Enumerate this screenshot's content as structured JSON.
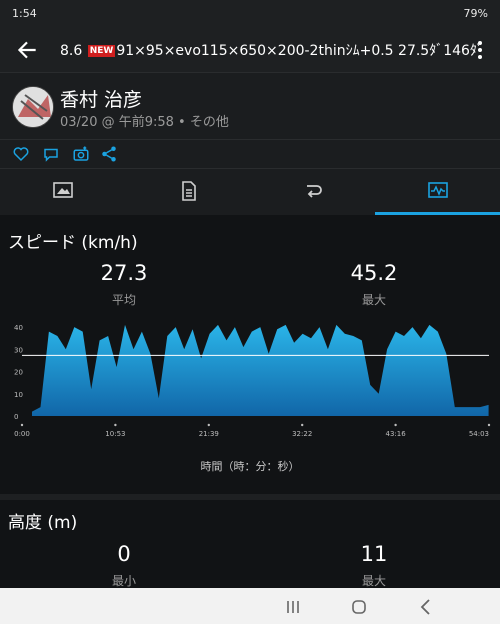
{
  "status_bar": {
    "time": "1:54",
    "battery": "79%"
  },
  "header": {
    "title_part1": "8.6",
    "new_badge": "NEW",
    "title_part2": "91×95×evo115×650×200-2thinｼﾑ+0.5  27.5ﾀﾞ146ﾀﾞ"
  },
  "profile": {
    "name": "香村 治彦",
    "meta": "03/20 @ 午前9:58 • その他"
  },
  "speed": {
    "title": "スピード (km/h)",
    "avg_value": "27.3",
    "avg_label": "平均",
    "max_value": "45.2",
    "max_label": "最大"
  },
  "chart_data": {
    "type": "area",
    "title": "スピード (km/h)",
    "xlabel": "時間（時：分：秒）",
    "ylabel": "",
    "x_tick_labels": [
      "0:00",
      "10:53",
      "21:39",
      "32:22",
      "43:16",
      "54:03"
    ],
    "y_tick_labels": [
      "0",
      "10",
      "20",
      "30",
      "40"
    ],
    "ylim": [
      0,
      45
    ],
    "xlim_minutes": [
      0,
      54.05
    ],
    "average_line": 27.3,
    "x": [
      0,
      1,
      2,
      3,
      4,
      5,
      6,
      7,
      8,
      9,
      10,
      11,
      12,
      13,
      14,
      15,
      16,
      17,
      18,
      19,
      20,
      21,
      22,
      23,
      24,
      25,
      26,
      27,
      28,
      29,
      30,
      31,
      32,
      33,
      34,
      35,
      36,
      37,
      38,
      39,
      40,
      41,
      42,
      43,
      44,
      45,
      46,
      47,
      48,
      49,
      50,
      51,
      52,
      53,
      54
    ],
    "values": [
      2,
      4,
      38,
      36,
      30,
      40,
      38,
      12,
      34,
      36,
      22,
      41,
      30,
      38,
      28,
      8,
      36,
      40,
      30,
      39,
      26,
      37,
      41,
      34,
      40,
      31,
      38,
      40,
      28,
      39,
      41,
      33,
      37,
      35,
      40,
      30,
      41,
      37,
      36,
      34,
      14,
      10,
      30,
      38,
      36,
      40,
      35,
      41,
      38,
      28,
      4,
      4,
      4,
      4,
      5
    ]
  },
  "axis_caption": "時間（時：分：秒）",
  "altitude": {
    "title": "高度 (m)",
    "min_value": "0",
    "min_label": "最小",
    "max_value": "11",
    "max_label": "最大"
  },
  "colors": {
    "accent": "#1ba2e0",
    "area_top": "#2ab4e8",
    "area_bottom": "#1166a8"
  }
}
